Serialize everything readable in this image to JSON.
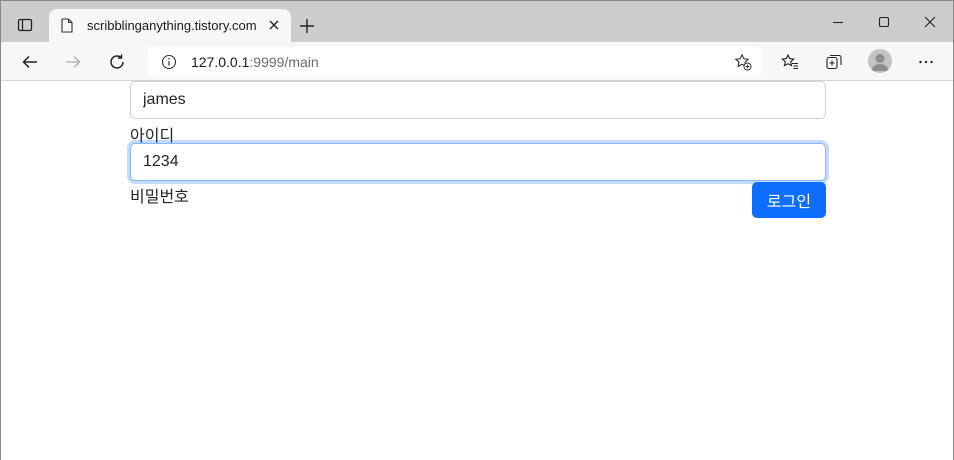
{
  "browser": {
    "tab": {
      "title": "scribblinganything.tistory.com"
    },
    "address": {
      "host": "127.0.0.1",
      "path": ":9999/main"
    }
  },
  "form": {
    "id_input": {
      "value": "james"
    },
    "id_label": "아이디",
    "pw_input": {
      "value": "1234"
    },
    "pw_label": "비밀번호",
    "login_button": "로그인"
  },
  "colors": {
    "accent": "#0d6efd",
    "tabbar": "#cdcdcd",
    "toolbar": "#f7f7f7"
  }
}
